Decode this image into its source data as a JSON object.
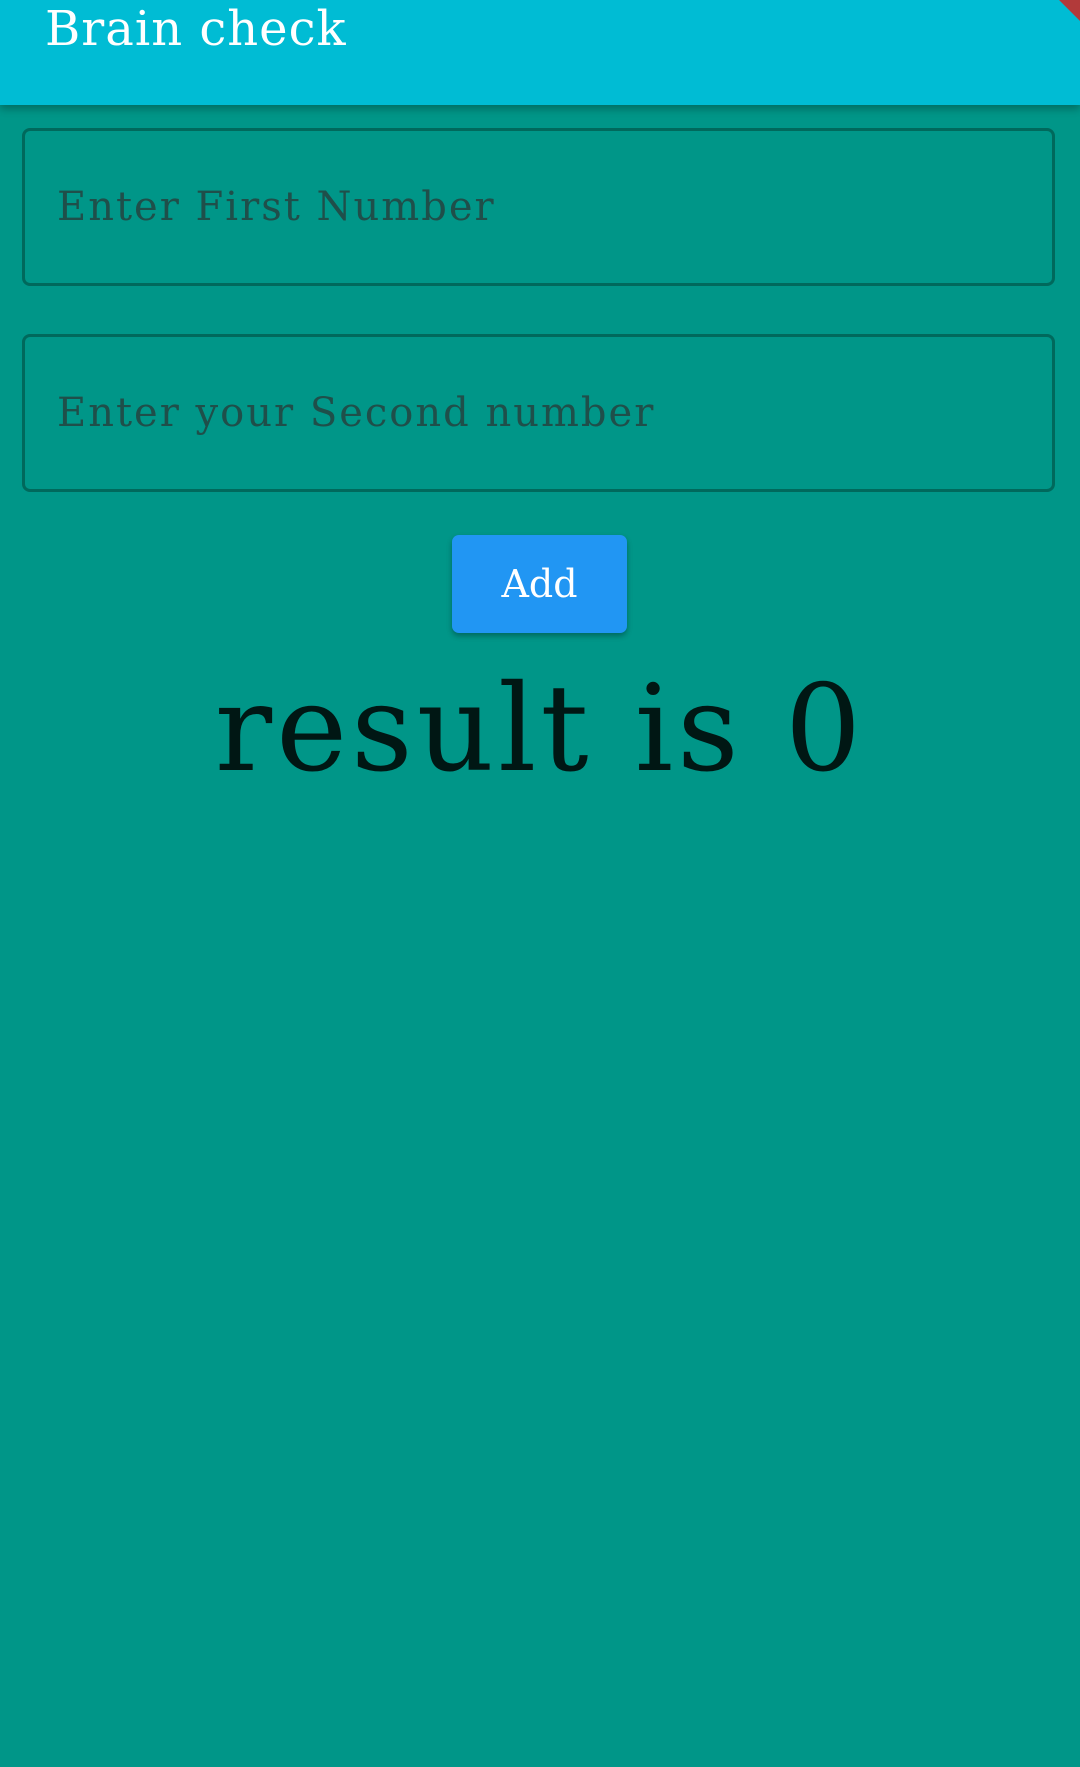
{
  "app_bar": {
    "title": "Brain check"
  },
  "form": {
    "first_number_placeholder": "Enter First Number",
    "second_number_placeholder": "Enter your Second number",
    "first_number_value": "",
    "second_number_value": "",
    "add_button_label": "Add"
  },
  "result": {
    "text": "result is 0"
  },
  "colors": {
    "app_bar": "#00BCD4",
    "background": "#009688",
    "field_border": "#00695C",
    "button": "#2196F3",
    "result_text": "#001714"
  }
}
